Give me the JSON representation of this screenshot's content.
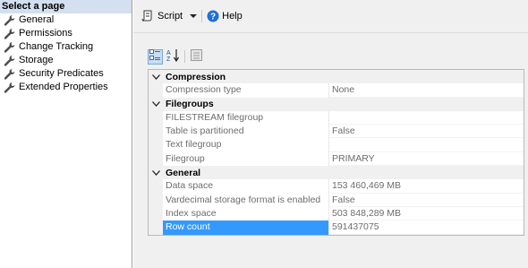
{
  "left": {
    "header": "Select a page",
    "items": [
      {
        "label": "General",
        "icon": "wrench-icon"
      },
      {
        "label": "Permissions",
        "icon": "wrench-icon"
      },
      {
        "label": "Change Tracking",
        "icon": "wrench-icon"
      },
      {
        "label": "Storage",
        "icon": "wrench-icon"
      },
      {
        "label": "Security Predicates",
        "icon": "wrench-icon"
      },
      {
        "label": "Extended Properties",
        "icon": "wrench-icon"
      }
    ]
  },
  "toolbar": {
    "script_label": "Script",
    "help_label": "Help"
  },
  "grid": {
    "categories": [
      {
        "title": "Compression",
        "props": [
          {
            "name": "Compression type",
            "value": "None"
          }
        ]
      },
      {
        "title": "Filegroups",
        "props": [
          {
            "name": "FILESTREAM filegroup",
            "value": ""
          },
          {
            "name": "Table is partitioned",
            "value": "False"
          },
          {
            "name": "Text filegroup",
            "value": ""
          },
          {
            "name": "Filegroup",
            "value": "PRIMARY"
          }
        ]
      },
      {
        "title": "General",
        "props": [
          {
            "name": "Data space",
            "value": "153 460,469 MB"
          },
          {
            "name": "Vardecimal storage format is enabled",
            "value": "False"
          },
          {
            "name": "Index space",
            "value": "503 848,289 MB"
          },
          {
            "name": "Row count",
            "value": "591437075",
            "selected": true
          }
        ]
      }
    ]
  },
  "colors": {
    "selection": "#3399ff",
    "header_bg": "#d4dfef",
    "help_blue": "#1e6fd9"
  }
}
